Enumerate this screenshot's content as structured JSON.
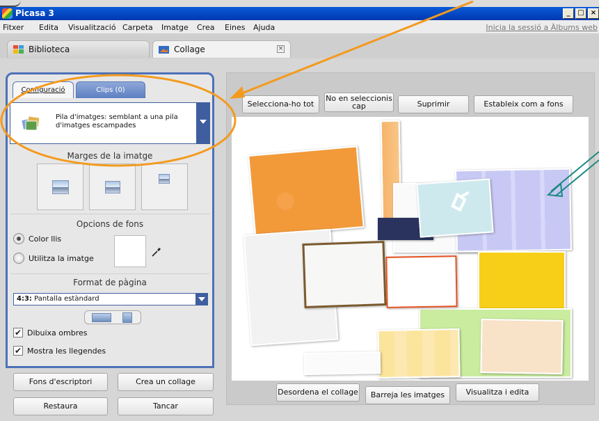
{
  "window": {
    "title": "Picasa 3",
    "minimize": "_",
    "maximize": "□",
    "close": "×"
  },
  "menu": {
    "items": [
      "Fitxer",
      "Edita",
      "Visualització",
      "Carpeta",
      "Imatge",
      "Crea",
      "Eines",
      "Ajuda"
    ],
    "signin": "Inicia la sessió a Àlbums web"
  },
  "tabs": {
    "library": "Biblioteca",
    "collage": "Collage"
  },
  "panel": {
    "tab_config": "Configuració",
    "tab_clips": "Clips (0)",
    "collage_style": "Pila d'imatges: semblant a una pila d'imatges escampades",
    "margins_title": "Marges de la imatge",
    "background_title": "Opcions de fons",
    "solid_color": "Color llis",
    "use_image": "Utilitza la imatge",
    "page_format_title": "Format de pàgina",
    "format_ratio": "4:3:",
    "format_name": "Pantalla estàndard",
    "draw_shadows": "Dibuixa ombres",
    "show_captions": "Mostra les llegendes",
    "desktop_bg_button": "Fons d'escriptori",
    "create_collage_button": "Crea un collage",
    "restore_button": "Restaura",
    "close_button": "Tancar"
  },
  "toolbar": {
    "select_all": "Selecciona-ho tot",
    "select_none_l1": "No en seleccionis",
    "select_none_l2": "cap",
    "delete": "Suprimir",
    "set_background": "Estableix com a fons"
  },
  "bottom": {
    "scramble": "Desordena el collage",
    "shuffle": "Barreja les imatges",
    "view_edit": "Visualitza i edita"
  },
  "colors": {
    "panel_border": "#4d71b8",
    "annotation_orange": "#f39a1e",
    "annotation_teal": "#1a8a80"
  }
}
